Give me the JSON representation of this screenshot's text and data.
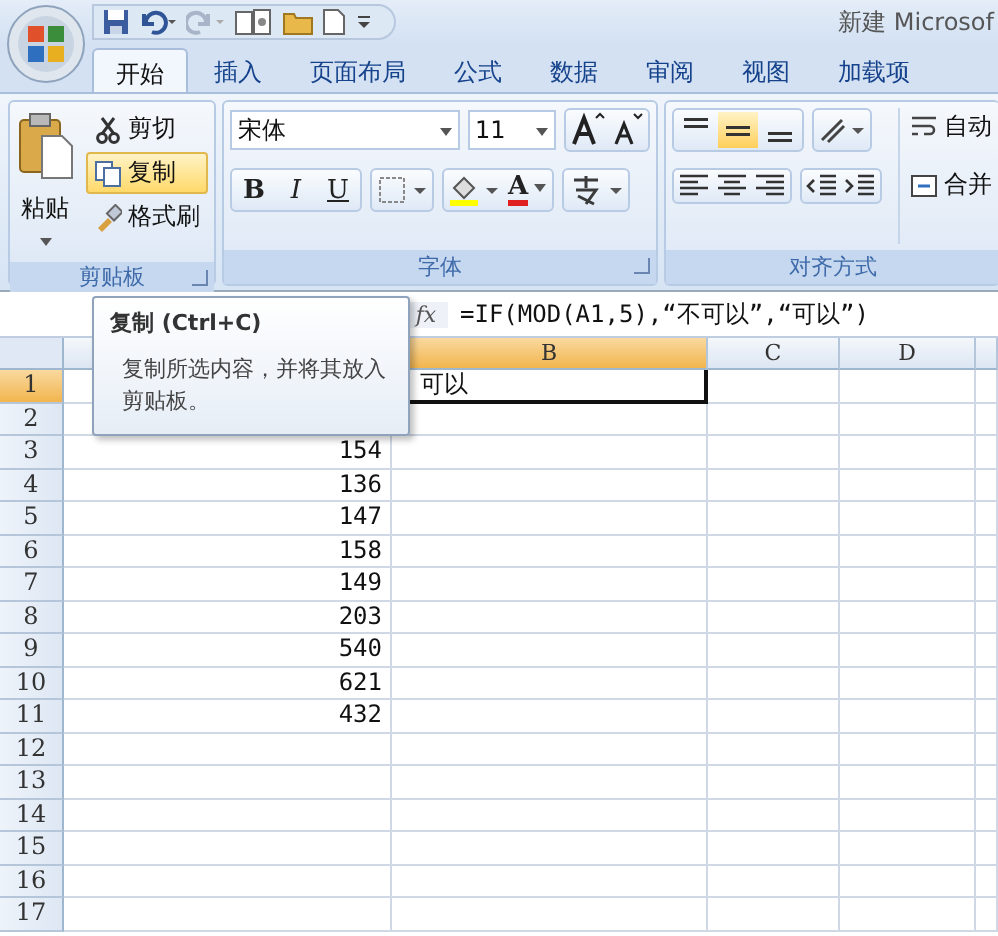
{
  "window": {
    "title": "新建 Microsof"
  },
  "tabs": [
    {
      "label": "开始",
      "selected": true
    },
    {
      "label": "插入",
      "selected": false
    },
    {
      "label": "页面布局",
      "selected": false
    },
    {
      "label": "公式",
      "selected": false
    },
    {
      "label": "数据",
      "selected": false
    },
    {
      "label": "审阅",
      "selected": false
    },
    {
      "label": "视图",
      "selected": false
    },
    {
      "label": "加载项",
      "selected": false
    }
  ],
  "clipboard": {
    "paste": "粘贴",
    "label": "剪贴板",
    "items": [
      {
        "kind": "cut",
        "label": "剪切",
        "hovered": false
      },
      {
        "kind": "copy",
        "label": "复制",
        "hovered": true
      },
      {
        "kind": "painter",
        "label": "格式刷",
        "hovered": false
      }
    ]
  },
  "font": {
    "name": "宋体",
    "size": "11",
    "styles": [
      "B",
      "I",
      "U"
    ],
    "color_glyph": "A",
    "label": "字体"
  },
  "alignment": {
    "label": "对齐方式",
    "vertical": [
      {
        "selected": false
      },
      {
        "selected": true
      },
      {
        "selected": false
      }
    ],
    "wrap_text": "自动",
    "merge": "合并"
  },
  "formula_bar": {
    "fx": "fx",
    "formula": "=IF(MOD(A1,5),“不可以”,“可以”)"
  },
  "columns": [
    {
      "label": "B",
      "selected": true
    },
    {
      "label": "C",
      "selected": false
    },
    {
      "label": "D",
      "selected": false
    }
  ],
  "rows": [
    {
      "number": "1",
      "selected": true,
      "b": "可以"
    },
    {
      "number": "2",
      "selected": false
    },
    {
      "number": "3",
      "selected": false,
      "a": "154"
    },
    {
      "number": "4",
      "selected": false,
      "a": "136"
    },
    {
      "number": "5",
      "selected": false,
      "a": "147"
    },
    {
      "number": "6",
      "selected": false,
      "a": "158"
    },
    {
      "number": "7",
      "selected": false,
      "a": "149"
    },
    {
      "number": "8",
      "selected": false,
      "a": "203"
    },
    {
      "number": "9",
      "selected": false,
      "a": "540"
    },
    {
      "number": "10",
      "selected": false,
      "a": "621"
    },
    {
      "number": "11",
      "selected": false,
      "a": "432"
    },
    {
      "number": "12",
      "selected": false
    },
    {
      "number": "13",
      "selected": false
    },
    {
      "number": "14",
      "selected": false
    },
    {
      "number": "15",
      "selected": false
    },
    {
      "number": "16",
      "selected": false
    },
    {
      "number": "17",
      "selected": false
    }
  ],
  "tooltip": {
    "title": "复制 (Ctrl+C)",
    "body": "复制所选内容，并将其放入剪贴板。"
  }
}
